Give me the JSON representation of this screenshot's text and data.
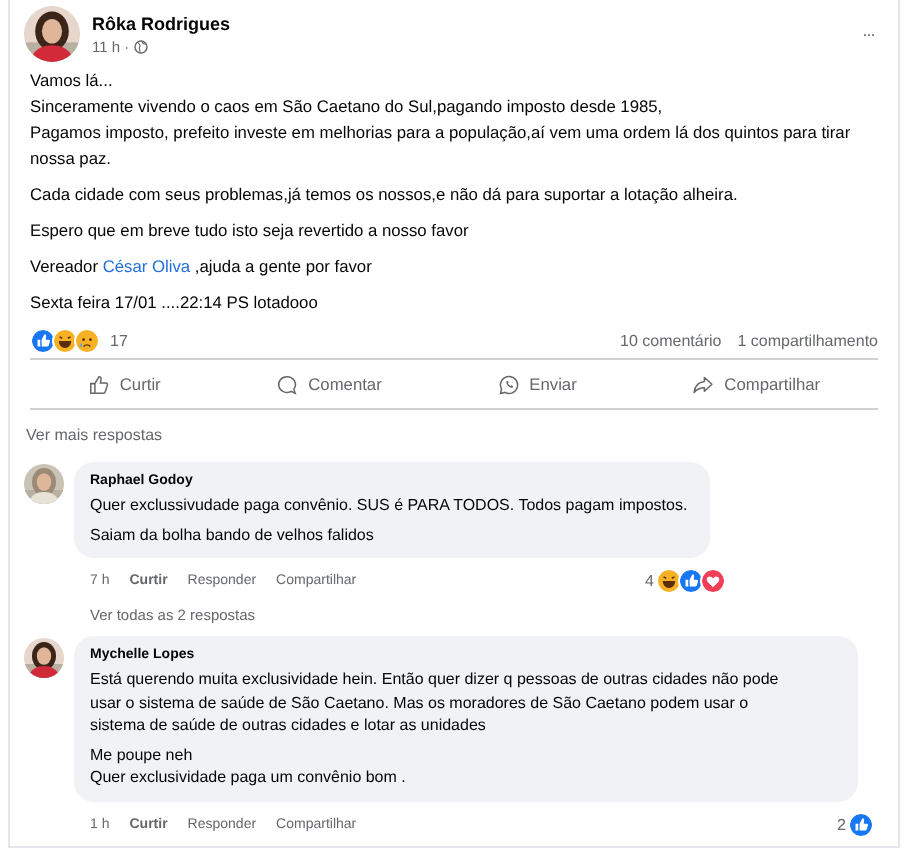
{
  "post": {
    "author": "Rôka Rodrigues",
    "time": "11 h ·",
    "more": "···",
    "paragraphs": [
      {
        "lines": [
          [
            {
              "kind": "text",
              "text": "Vamos lá..."
            }
          ],
          [
            {
              "kind": "text",
              "text": "Sinceramente vivendo o caos em São Caetano do Sul,pagando imposto desde 1985,"
            }
          ],
          [
            {
              "kind": "text",
              "text": "Pagamos imposto, prefeito investe em melhorias para a população,aí vem uma ordem lá dos quintos para tirar"
            }
          ],
          [
            {
              "kind": "text",
              "text": "nossa paz."
            }
          ]
        ]
      },
      {
        "lines": [
          [
            {
              "kind": "text",
              "text": "Cada cidade com seus problemas,já temos os nossos,e não dá para suportar a lotação alheira."
            }
          ]
        ]
      },
      {
        "lines": [
          [
            {
              "kind": "text",
              "text": "Espero que em breve tudo isto seja revertido a nosso favor"
            }
          ]
        ]
      },
      {
        "lines": [
          [
            {
              "kind": "text",
              "text": "Vereador "
            },
            {
              "kind": "link",
              "text": "César Oliva"
            },
            {
              "kind": "text",
              "text": " ,ajuda a gente por favor"
            }
          ]
        ]
      },
      {
        "lines": [
          [
            {
              "kind": "text",
              "text": "Sexta feira 17/01 ....22:14 PS lotadooo"
            }
          ]
        ]
      }
    ],
    "reactions": [
      {
        "kind": "like"
      },
      {
        "kind": "haha"
      },
      {
        "kind": "sad"
      }
    ],
    "reaction_count": "17",
    "comments_count": "10 comentário",
    "shares_count": "1 compartilhamento",
    "actions": [
      {
        "kind": "like",
        "label": "Curtir"
      },
      {
        "kind": "comment",
        "label": "Comentar"
      },
      {
        "kind": "send",
        "label": "Enviar"
      },
      {
        "kind": "share",
        "label": "Compartilhar"
      }
    ]
  },
  "more_replies": "Ver mais respostas",
  "comments": [
    {
      "author": "Raphael Godoy",
      "paragraphs": [
        [
          "Quer exclussivudade paga convênio. SUS é PARA TODOS. Todos pagam impostos."
        ],
        [
          "Saiam da bolha bando de velhos falidos"
        ]
      ],
      "time": "7 h",
      "actions": [
        "Curtir",
        "Responder",
        "Compartilhar"
      ],
      "reaction_count": "4",
      "reactions": [
        {
          "kind": "haha"
        },
        {
          "kind": "like"
        },
        {
          "kind": "love"
        }
      ],
      "replies_link": "Ver todas as 2 respostas"
    },
    {
      "author": "Mychelle Lopes",
      "paragraphs": [
        [
          "Está querendo muita exclusividade hein. Então quer dizer q pessoas de outras cidades não pode",
          "usar o sistema de saúde de São Caetano. Mas os moradores de São Caetano podem usar o",
          "sistema de saúde de outras cidades e lotar as unidades"
        ],
        [
          "Me poupe neh",
          "Quer exclusividade paga um convênio bom ."
        ]
      ],
      "time": "1 h",
      "actions": [
        "Curtir",
        "Responder",
        "Compartilhar"
      ],
      "reaction_count": "2",
      "reactions": [
        {
          "kind": "like"
        }
      ]
    }
  ]
}
